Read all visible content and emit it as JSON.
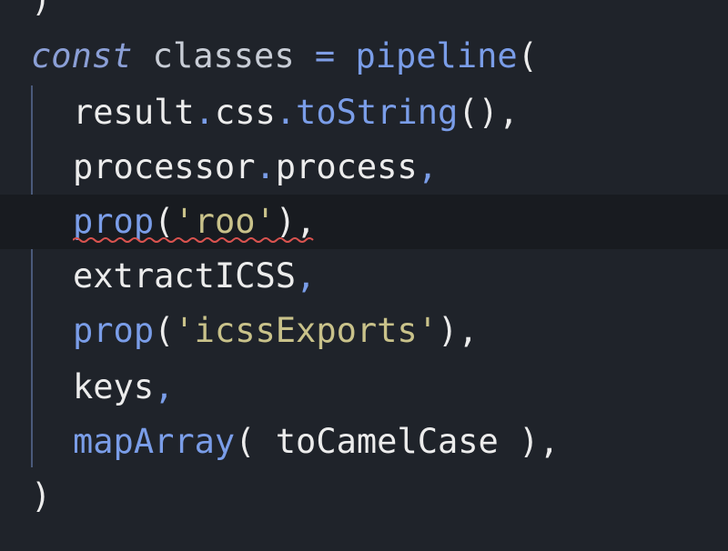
{
  "colors": {
    "background": "#1f232a",
    "current_line": "#181b20",
    "keyword": "#8b9fd6",
    "function": "#7a9de8",
    "string": "#c9c28a",
    "identifier": "#ececec",
    "error_squiggle": "#d9534f"
  },
  "lines": {
    "l0": {
      "text": ")"
    },
    "l1": {
      "keyword": "const",
      "name": "classes",
      "op": "=",
      "fn": "pipeline",
      "open": "("
    },
    "l2": {
      "obj": "result",
      "prop": "css",
      "method": "toString",
      "tail": "(),"
    },
    "l3": {
      "obj": "processor",
      "prop": "process",
      "tail": ","
    },
    "l4": {
      "fn": "prop",
      "open": "(",
      "str": "'roo'",
      "tail": "),"
    },
    "l5": {
      "name": "extractICSS",
      "tail": ","
    },
    "l6": {
      "fn": "prop",
      "open": "(",
      "str": "'icssExports'",
      "tail": "),"
    },
    "l7": {
      "name": "keys",
      "tail": ","
    },
    "l8": {
      "fn": "mapArray",
      "open": "( ",
      "arg": "toCamelCase",
      "tail": " ),"
    },
    "l9": {
      "text": ")"
    }
  }
}
